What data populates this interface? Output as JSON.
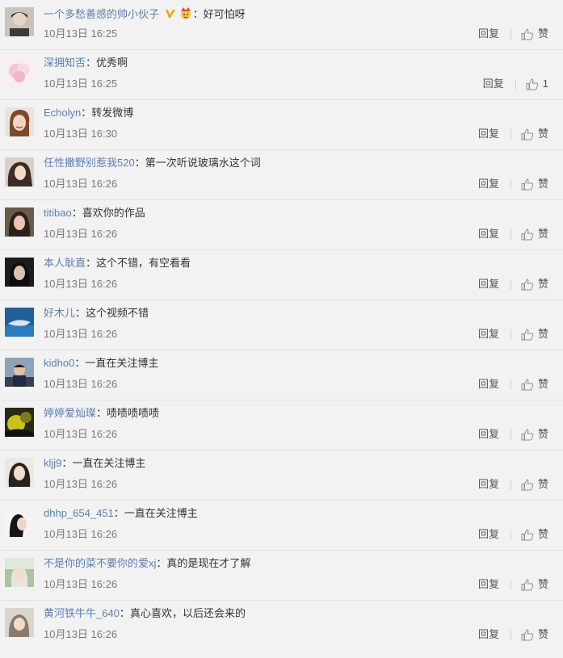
{
  "comments": [
    {
      "user": "一个多愁善感的帅小伙子",
      "sep": "：",
      "text": "好可怕呀",
      "time": "10月13日 16:25",
      "reply": "回复",
      "like": "赞",
      "badges": [
        "vip-v-icon",
        "crown-face-icon"
      ]
    },
    {
      "user": "深拥知否",
      "sep": "：",
      "text": "优秀啊",
      "time": "10月13日 16:25",
      "reply": "回复",
      "like": "1"
    },
    {
      "user": "Echolyn",
      "sep": "：",
      "text": "转发微博",
      "time": "10月13日 16:30",
      "reply": "回复",
      "like": "赞"
    },
    {
      "user": "任性撒野别惹我520",
      "sep": "：",
      "text": "第一次听说玻璃水这个词",
      "time": "10月13日 16:26",
      "reply": "回复",
      "like": "赞"
    },
    {
      "user": "titibao",
      "sep": "：",
      "text": "喜欢你的作品",
      "time": "10月13日 16:26",
      "reply": "回复",
      "like": "赞"
    },
    {
      "user": "本人耿直",
      "sep": "：",
      "text": "这个不错，有空看看",
      "time": "10月13日 16:26",
      "reply": "回复",
      "like": "赞"
    },
    {
      "user": "好木儿",
      "sep": "：",
      "text": "这个视频不错",
      "time": "10月13日 16:26",
      "reply": "回复",
      "like": "赞"
    },
    {
      "user": "kidho0",
      "sep": "：",
      "text": "一直在关注博主",
      "time": "10月13日 16:26",
      "reply": "回复",
      "like": "赞"
    },
    {
      "user": "婷婷爱灿璨",
      "sep": "：",
      "text": "啧啧啧啧啧",
      "time": "10月13日 16:26",
      "reply": "回复",
      "like": "赞"
    },
    {
      "user": "kljj9",
      "sep": "：",
      "text": "一直在关注博主",
      "time": "10月13日 16:26",
      "reply": "回复",
      "like": "赞"
    },
    {
      "user": "dhhp_654_451",
      "sep": "：",
      "text": "一直在关注博主",
      "time": "10月13日 16:26",
      "reply": "回复",
      "like": "赞"
    },
    {
      "user": "不是你的菜不要你的爱xj",
      "sep": "：",
      "text": "真的是现在才了解",
      "time": "10月13日 16:26",
      "reply": "回复",
      "like": "赞"
    },
    {
      "user": "黄河铁牛牛_640",
      "sep": "：",
      "text": "真心喜欢，以后还会来的",
      "time": "10月13日 16:26",
      "reply": "回复",
      "like": "赞"
    }
  ],
  "colors": {
    "username": "#5b7fb0",
    "text": "#333333",
    "time": "#7a7a7a",
    "background": "#f2f2f2",
    "divider": "#e2e2e2"
  }
}
